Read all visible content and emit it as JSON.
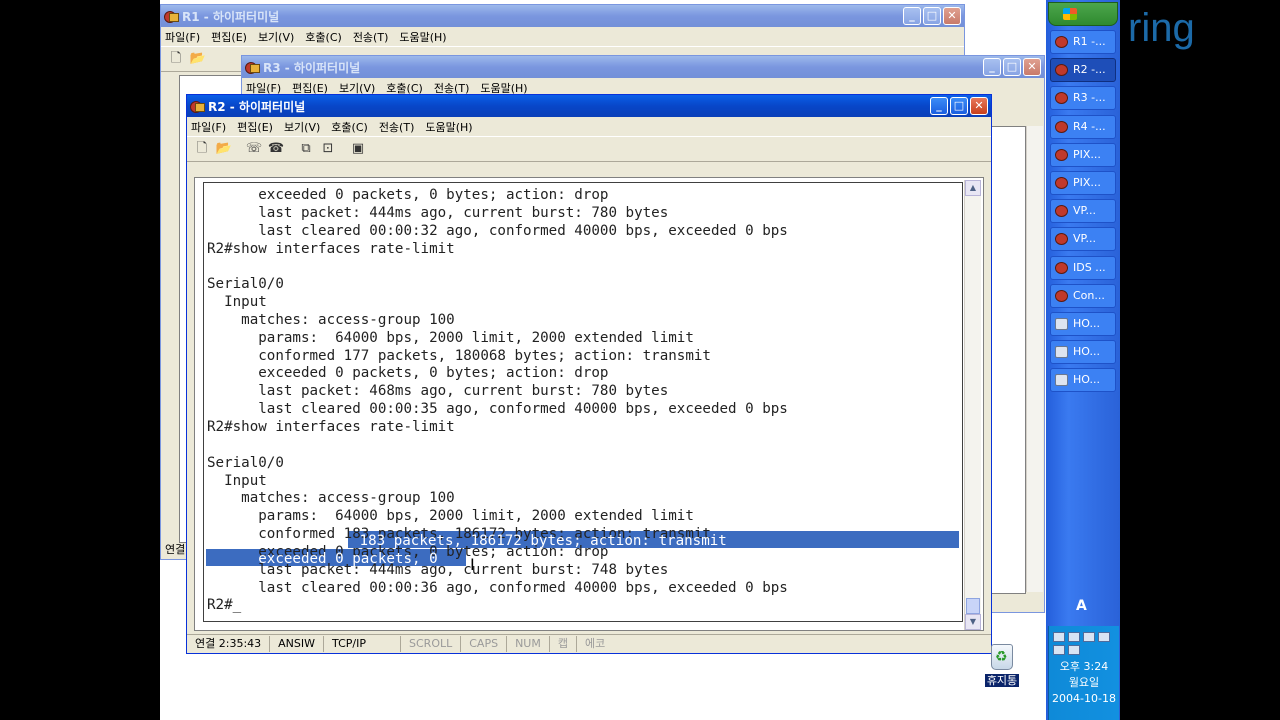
{
  "desktop_text": "ring",
  "windows": {
    "r1": {
      "title": "R1 - 하이퍼터미널",
      "menu": [
        "파일(F)",
        "편집(E)",
        "보기(V)",
        "호출(C)",
        "전송(T)",
        "도움말(H)"
      ],
      "status_fragment": "연결"
    },
    "r3": {
      "title": "R3 - 하이퍼터미널",
      "menu": [
        "파일(F)",
        "편집(E)",
        "보기(V)",
        "호출(C)",
        "전송(T)",
        "도움말(H)"
      ]
    },
    "r2": {
      "title": "R2 - 하이퍼터미널",
      "menu": [
        "파일(F)",
        "편집(E)",
        "보기(V)",
        "호출(C)",
        "전송(T)",
        "도움말(H)"
      ],
      "terminal_lines": [
        "      exceeded 0 packets, 0 bytes; action: drop",
        "      last packet: 444ms ago, current burst: 780 bytes",
        "      last cleared 00:00:32 ago, conformed 40000 bps, exceeded 0 bps",
        "R2#show interfaces rate-limit",
        "",
        "Serial0/0",
        "  Input",
        "    matches: access-group 100",
        "      params:  64000 bps, 2000 limit, 2000 extended limit",
        "      conformed 177 packets, 180068 bytes; action: transmit",
        "      exceeded 0 packets, 0 bytes; action: drop",
        "      last packet: 468ms ago, current burst: 780 bytes",
        "      last cleared 00:00:35 ago, conformed 40000 bps, exceeded 0 bps",
        "R2#show interfaces rate-limit",
        "",
        "Serial0/0",
        "  Input",
        "    matches: access-group 100",
        "      params:  64000 bps, 2000 limit, 2000 extended limit",
        "      conformed 183 packets, 186172 bytes; action: transmit",
        "      exceeded 0 packets, 0 bytes; action: drop",
        "      last packet: 444ms ago, current burst: 748 bytes",
        "      last cleared 00:00:36 ago, conformed 40000 bps, exceeded 0 bps",
        "R2#_"
      ],
      "selection_line1": " 183 packets, 186172 bytes; action: transmit",
      "selection_line2": "      exceeded 0 packets, 0",
      "status": {
        "connected": "연결 2:35:43",
        "emulation": "ANSIW",
        "protocol": "TCP/IP",
        "scroll": "SCROLL",
        "caps": "CAPS",
        "num": "NUM",
        "capture": "캡",
        "echo": "에코"
      }
    }
  },
  "taskbar": {
    "items": [
      {
        "label": "R1 -...",
        "kind": "terminal",
        "active": false
      },
      {
        "label": "R2 -...",
        "kind": "terminal",
        "active": true
      },
      {
        "label": "R3 -...",
        "kind": "terminal",
        "active": false
      },
      {
        "label": "R4 -...",
        "kind": "terminal",
        "active": false
      },
      {
        "label": "PIX...",
        "kind": "terminal",
        "active": false
      },
      {
        "label": "PIX...",
        "kind": "terminal",
        "active": false
      },
      {
        "label": "VP...",
        "kind": "terminal",
        "active": false
      },
      {
        "label": "VP...",
        "kind": "terminal",
        "active": false
      },
      {
        "label": "IDS ...",
        "kind": "terminal",
        "active": false
      },
      {
        "label": "Con...",
        "kind": "terminal",
        "active": false
      },
      {
        "label": "HO...",
        "kind": "host",
        "active": false
      },
      {
        "label": "HO...",
        "kind": "host",
        "active": false
      },
      {
        "label": "HO...",
        "kind": "host",
        "active": false
      }
    ],
    "language": "A",
    "clock": {
      "time": "오후 3:24",
      "day": "월요일",
      "date": "2004-10-18"
    }
  },
  "recycle_bin_label": "휴지통"
}
